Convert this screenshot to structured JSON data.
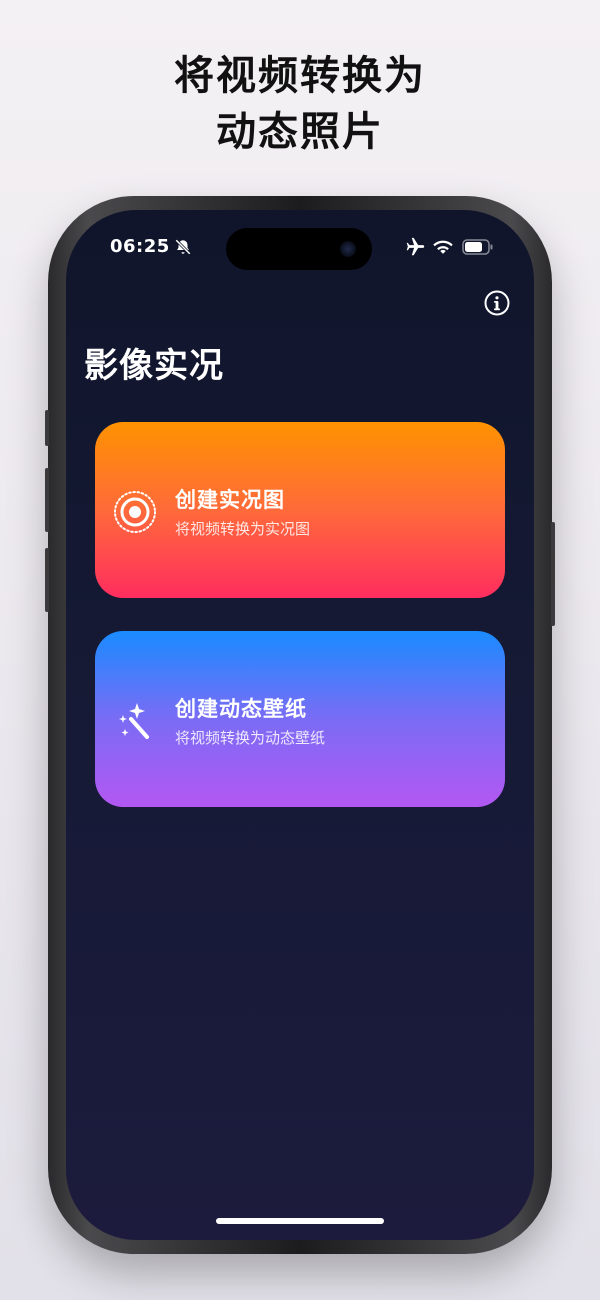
{
  "promo": {
    "headline_line1": "将视频转换为",
    "headline_line2": "动态照片"
  },
  "status_bar": {
    "time": "06:25",
    "icons": [
      "bell-slash-icon",
      "airplane-icon",
      "wifi-icon",
      "battery-icon"
    ]
  },
  "app": {
    "title": "影像实况",
    "info_icon": "info-circle-icon"
  },
  "cards": [
    {
      "title": "创建实况图",
      "subtitle": "将视频转换为实况图",
      "icon": "live-photo-icon",
      "gradient": [
        "#ff9300",
        "#ff2d5f"
      ]
    },
    {
      "title": "创建动态壁纸",
      "subtitle": "将视频转换为动态壁纸",
      "icon": "magic-wand-icon",
      "gradient": [
        "#1a8bff",
        "#b457f2"
      ]
    }
  ],
  "colors": {
    "screen_background": "#10152b",
    "text_primary": "#ffffff"
  }
}
